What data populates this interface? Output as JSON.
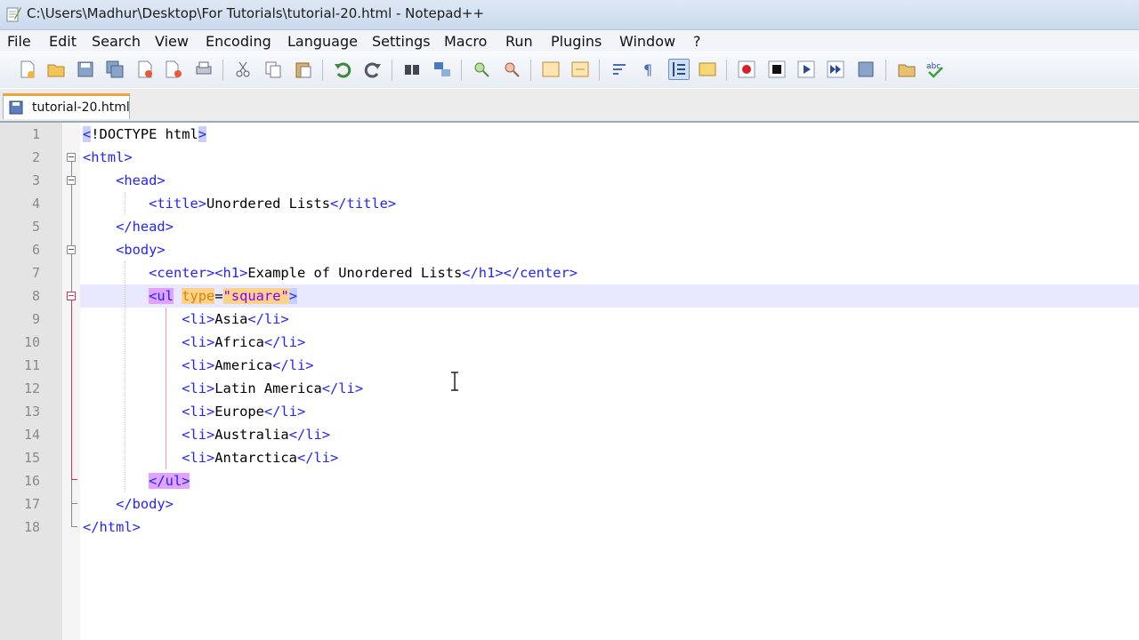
{
  "window": {
    "title": "C:\\Users\\Madhur\\Desktop\\For Tutorials\\tutorial-20.html - Notepad++"
  },
  "menu": {
    "items": [
      "File",
      "Edit",
      "Search",
      "View",
      "Encoding",
      "Language",
      "Settings",
      "Macro",
      "Run",
      "Plugins",
      "Window",
      "?"
    ]
  },
  "toolbar": {
    "buttons": [
      "new-file-icon",
      "open-file-icon",
      "save-icon",
      "save-all-icon",
      "close-icon",
      "close-all-icon",
      "print-icon",
      "cut-icon",
      "copy-icon",
      "paste-icon",
      "undo-icon",
      "redo-icon",
      "find-icon",
      "replace-icon",
      "zoom-in-icon",
      "zoom-out-icon",
      "sync-vertical-icon",
      "sync-horizontal-icon",
      "word-wrap-icon",
      "show-all-characters-icon",
      "indent-guide-icon",
      "doc-map-icon",
      "record-macro-icon",
      "stop-recording-icon",
      "playback-macro-icon",
      "run-macro-multiple-icon",
      "save-macro-icon",
      "folder-icon",
      "spell-check-icon"
    ]
  },
  "tab": {
    "label": "tutorial-20.html"
  },
  "editor": {
    "current_line": 8,
    "line_numbers": [
      "1",
      "2",
      "3",
      "4",
      "5",
      "6",
      "7",
      "8",
      "9",
      "10",
      "11",
      "12",
      "13",
      "14",
      "15",
      "16",
      "17",
      "18"
    ],
    "lines": [
      {
        "indent": "",
        "tokens": [
          {
            "t": "tag",
            "v": "<"
          },
          {
            "t": "txt",
            "v": "!DOCTYPE html"
          },
          {
            "t": "tag",
            "v": ">"
          }
        ]
      },
      {
        "indent": "",
        "tokens": [
          {
            "t": "tag",
            "v": "<html>"
          }
        ]
      },
      {
        "indent": "    ",
        "tokens": [
          {
            "t": "tag",
            "v": "<head>"
          }
        ]
      },
      {
        "indent": "        ",
        "tokens": [
          {
            "t": "tag",
            "v": "<title>"
          },
          {
            "t": "txt",
            "v": "Unordered Lists"
          },
          {
            "t": "tag",
            "v": "</title>"
          }
        ]
      },
      {
        "indent": "    ",
        "tokens": [
          {
            "t": "tag",
            "v": "</head>"
          }
        ]
      },
      {
        "indent": "    ",
        "tokens": [
          {
            "t": "tag",
            "v": "<body>"
          }
        ]
      },
      {
        "indent": "        ",
        "tokens": [
          {
            "t": "tag",
            "v": "<center><h1>"
          },
          {
            "t": "txt",
            "v": "Example of Unordered Lists"
          },
          {
            "t": "tag",
            "v": "</h1></center>"
          }
        ]
      },
      {
        "indent": "        ",
        "tokens": [
          {
            "t": "tag",
            "v": "<ul"
          },
          {
            "t": "txt",
            "v": " "
          },
          {
            "t": "attr",
            "v": "type"
          },
          {
            "t": "txt",
            "v": "="
          },
          {
            "t": "str",
            "v": "\"square\""
          },
          {
            "t": "tag",
            "v": ">"
          }
        ]
      },
      {
        "indent": "            ",
        "tokens": [
          {
            "t": "tag",
            "v": "<li>"
          },
          {
            "t": "txt",
            "v": "Asia"
          },
          {
            "t": "tag",
            "v": "</li>"
          }
        ]
      },
      {
        "indent": "            ",
        "tokens": [
          {
            "t": "tag",
            "v": "<li>"
          },
          {
            "t": "txt",
            "v": "Africa"
          },
          {
            "t": "tag",
            "v": "</li>"
          }
        ]
      },
      {
        "indent": "            ",
        "tokens": [
          {
            "t": "tag",
            "v": "<li>"
          },
          {
            "t": "txt",
            "v": "America"
          },
          {
            "t": "tag",
            "v": "</li>"
          }
        ]
      },
      {
        "indent": "            ",
        "tokens": [
          {
            "t": "tag",
            "v": "<li>"
          },
          {
            "t": "txt",
            "v": "Latin America"
          },
          {
            "t": "tag",
            "v": "</li>"
          }
        ]
      },
      {
        "indent": "            ",
        "tokens": [
          {
            "t": "tag",
            "v": "<li>"
          },
          {
            "t": "txt",
            "v": "Europe"
          },
          {
            "t": "tag",
            "v": "</li>"
          }
        ]
      },
      {
        "indent": "            ",
        "tokens": [
          {
            "t": "tag",
            "v": "<li>"
          },
          {
            "t": "txt",
            "v": "Australia"
          },
          {
            "t": "tag",
            "v": "</li>"
          }
        ]
      },
      {
        "indent": "            ",
        "tokens": [
          {
            "t": "tag",
            "v": "<li>"
          },
          {
            "t": "txt",
            "v": "Antarctica"
          },
          {
            "t": "tag",
            "v": "</li>"
          }
        ]
      },
      {
        "indent": "        ",
        "tokens": [
          {
            "t": "tag",
            "v": "</ul>"
          }
        ]
      },
      {
        "indent": "    ",
        "tokens": [
          {
            "t": "tag",
            "v": "</body>"
          }
        ]
      },
      {
        "indent": "",
        "tokens": [
          {
            "t": "tag",
            "v": "</html>"
          }
        ]
      }
    ]
  }
}
